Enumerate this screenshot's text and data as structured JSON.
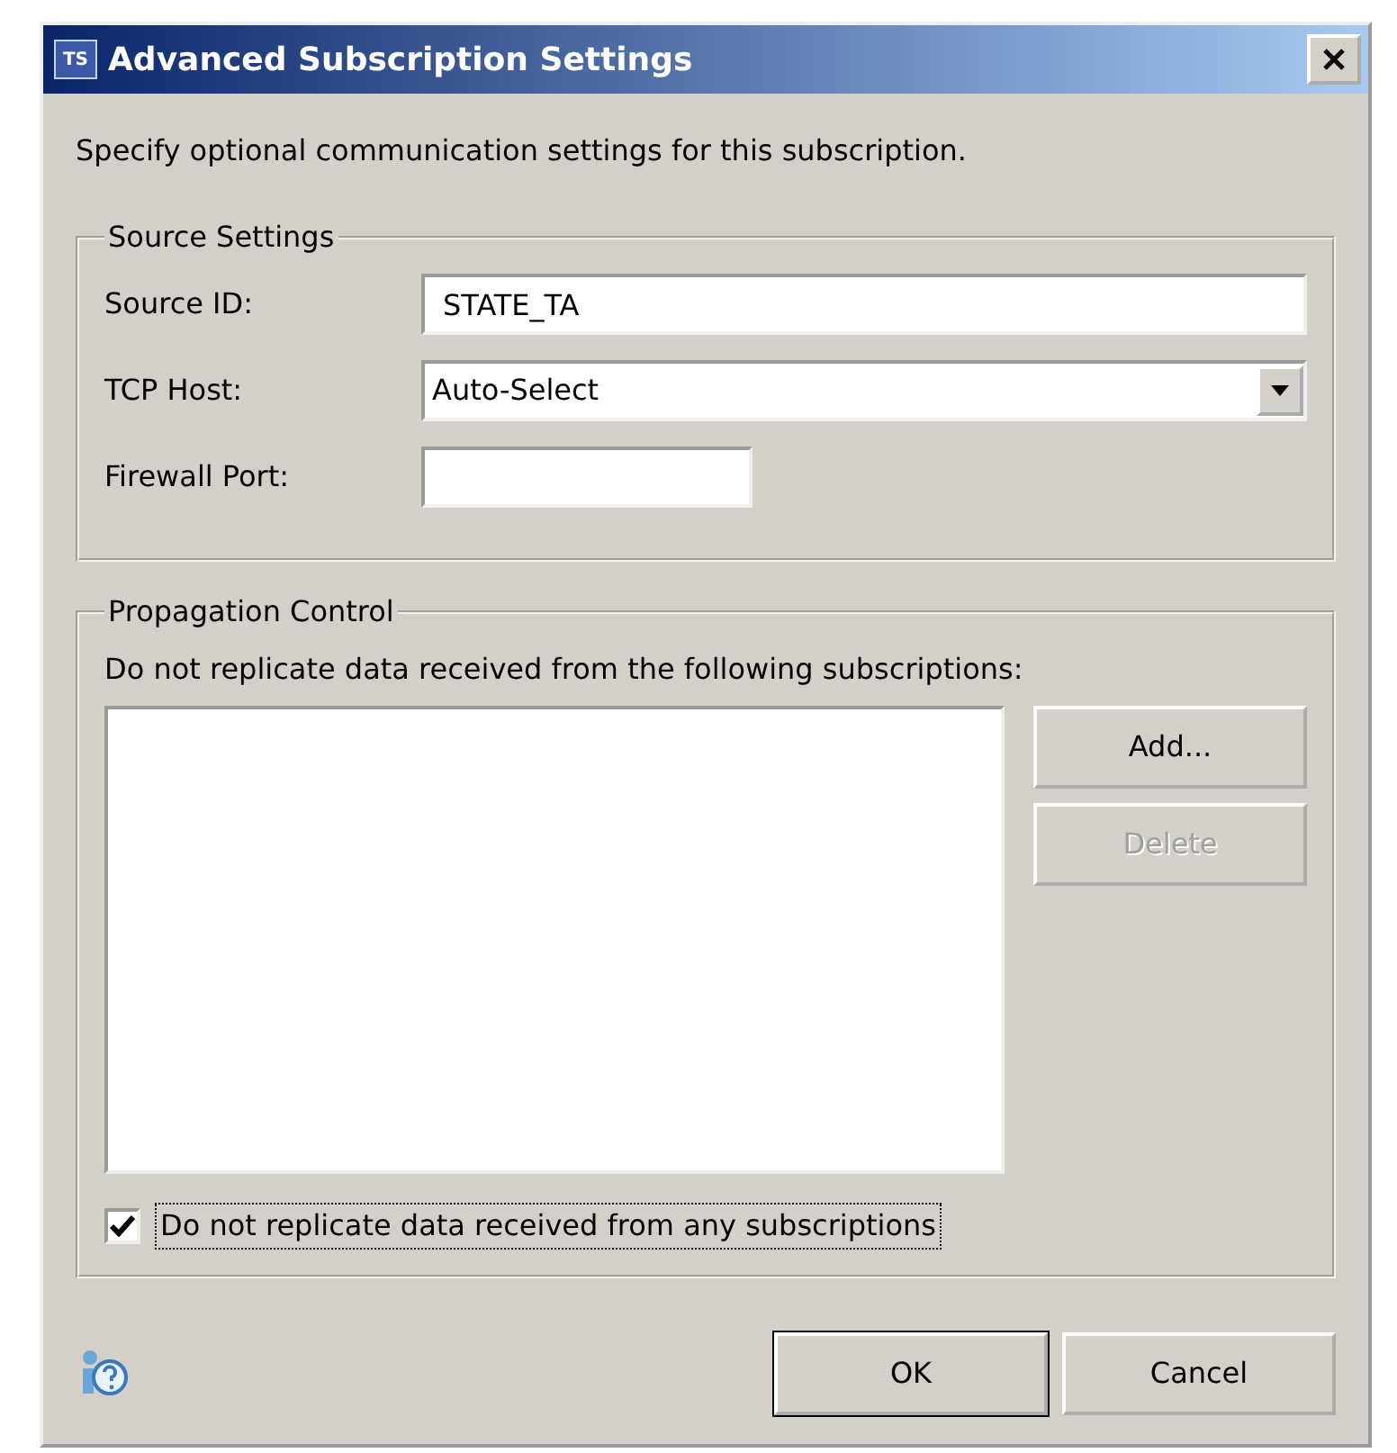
{
  "window": {
    "title": "Advanced Subscription Settings",
    "icon_text": "TS"
  },
  "intro": "Specify optional communication settings for this subscription.",
  "source_settings": {
    "title": "Source Settings",
    "fields": [
      {
        "kind": "text",
        "label": "Source ID:",
        "value": "STATE_TA"
      },
      {
        "kind": "select",
        "label": "TCP Host:",
        "value": "Auto-Select"
      },
      {
        "kind": "short",
        "label": "Firewall Port:"
      }
    ]
  },
  "propagation_control": {
    "title": "Propagation Control",
    "description": "Do not replicate data received from the following subscriptions:",
    "buttons": [
      {
        "label": "Add...",
        "disabled": false
      },
      {
        "label": "Delete",
        "disabled": true
      }
    ],
    "checkbox": {
      "label": "Do not replicate data received from any subscriptions",
      "checked": true
    }
  },
  "buttons": [
    {
      "label": "OK",
      "default": true
    },
    {
      "label": "Cancel",
      "default": false
    }
  ]
}
